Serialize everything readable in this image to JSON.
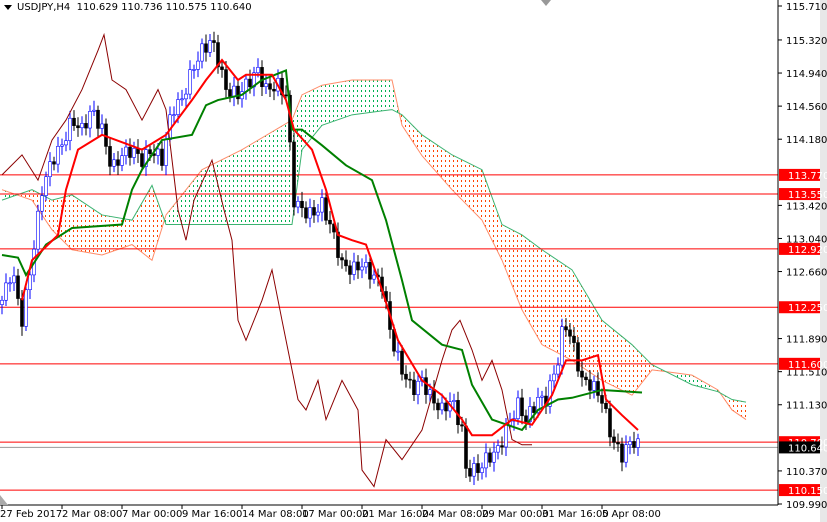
{
  "header": {
    "symbol": "USDJPY,H4",
    "ohlc": "110.629 110.736 110.575 110.640"
  },
  "colors": {
    "bull": "#0000ff",
    "bear": "#000000",
    "tenkan": "#ff0000",
    "kijun": "#008000",
    "chikou": "#8b0000",
    "cloud_up": "#00b050",
    "cloud_down": "#ff4500",
    "level": "#ff0000"
  },
  "chart_data": {
    "type": "candlestick",
    "title": "USDJPY,H4",
    "ylim": [
      109.99,
      115.71
    ],
    "y_ticks": [
      "115.710",
      "115.320",
      "114.940",
      "114.560",
      "114.180",
      "113.420",
      "113.040",
      "112.660",
      "111.890",
      "111.510",
      "111.130",
      "110.370",
      "109.990"
    ],
    "x_labels": [
      "27 Feb 2017",
      "2 Mar 08:00",
      "7 Mar 00:00",
      "9 Mar 16:00",
      "14 Mar 08:00",
      "17 Mar 00:00",
      "21 Mar 16:00",
      "24 Mar 08:00",
      "29 Mar 00:00",
      "31 Mar 16:00",
      "5 Apr 08:00"
    ],
    "bars_per_label": 15,
    "close": [
      [
        0,
        112.33
      ],
      [
        2.5,
        112.68
      ],
      [
        5,
        112.1
      ],
      [
        7.5,
        112.79
      ],
      [
        10,
        113.6
      ],
      [
        12.5,
        113.94
      ],
      [
        15,
        114.11
      ],
      [
        17.5,
        114.4
      ],
      [
        20,
        114.29
      ],
      [
        22.5,
        114.52
      ],
      [
        25,
        114.29
      ],
      [
        27.5,
        113.83
      ],
      [
        30,
        114.0
      ],
      [
        32.5,
        114.06
      ],
      [
        35,
        113.94
      ],
      [
        37.5,
        114.06
      ],
      [
        40,
        113.94
      ],
      [
        42.5,
        114.52
      ],
      [
        45,
        114.63
      ],
      [
        47.5,
        114.97
      ],
      [
        50,
        115.2
      ],
      [
        52.5,
        115.32
      ],
      [
        54,
        115.09
      ],
      [
        56,
        114.75
      ],
      [
        59,
        114.69
      ],
      [
        61,
        114.8
      ],
      [
        64,
        114.97
      ],
      [
        66,
        114.75
      ],
      [
        69,
        114.8
      ],
      [
        71,
        114.69
      ],
      [
        73,
        113.48
      ],
      [
        75,
        113.37
      ],
      [
        77.5,
        113.31
      ],
      [
        80,
        113.43
      ],
      [
        82.5,
        113.14
      ],
      [
        85,
        112.74
      ],
      [
        87.5,
        112.68
      ],
      [
        90,
        112.74
      ],
      [
        92.5,
        112.62
      ],
      [
        95,
        112.51
      ],
      [
        97.5,
        111.87
      ],
      [
        100,
        111.53
      ],
      [
        102.5,
        111.3
      ],
      [
        105,
        111.41
      ],
      [
        107.5,
        111.19
      ],
      [
        110,
        111.07
      ],
      [
        112.5,
        111.19
      ],
      [
        115,
        110.84
      ],
      [
        116,
        110.38
      ],
      [
        119,
        110.38
      ],
      [
        121,
        110.5
      ],
      [
        124,
        110.61
      ],
      [
        126,
        110.84
      ],
      [
        129,
        111.13
      ],
      [
        131,
        110.96
      ],
      [
        134,
        111.19
      ],
      [
        136,
        111.19
      ],
      [
        139,
        111.64
      ],
      [
        140.5,
        112.1
      ],
      [
        142.5,
        111.87
      ],
      [
        145,
        111.41
      ],
      [
        147.5,
        111.36
      ],
      [
        150,
        111.19
      ],
      [
        152.5,
        110.73
      ],
      [
        155,
        110.55
      ],
      [
        157.5,
        110.73
      ],
      [
        159.5,
        110.64
      ]
    ],
    "tenkan": [
      [
        5,
        112.33
      ],
      [
        7.5,
        112.79
      ],
      [
        14,
        113.08
      ],
      [
        16,
        113.6
      ],
      [
        19,
        114.06
      ],
      [
        25,
        114.23
      ],
      [
        35,
        114.06
      ],
      [
        41,
        114.23
      ],
      [
        47.5,
        114.63
      ],
      [
        51,
        114.86
      ],
      [
        55,
        115.09
      ],
      [
        59,
        114.86
      ],
      [
        61,
        114.92
      ],
      [
        67.5,
        114.92
      ],
      [
        71,
        114.63
      ],
      [
        73,
        114.29
      ],
      [
        77.5,
        114.06
      ],
      [
        81,
        113.6
      ],
      [
        84,
        113.08
      ],
      [
        87.5,
        113.02
      ],
      [
        91,
        112.97
      ],
      [
        95,
        112.45
      ],
      [
        99,
        111.87
      ],
      [
        105,
        111.41
      ],
      [
        110,
        111.24
      ],
      [
        115,
        110.96
      ],
      [
        117.5,
        110.78
      ],
      [
        122.5,
        110.78
      ],
      [
        127.5,
        110.96
      ],
      [
        132.5,
        110.9
      ],
      [
        137.5,
        111.24
      ],
      [
        141,
        111.64
      ],
      [
        145,
        111.64
      ],
      [
        149,
        111.7
      ],
      [
        151,
        111.19
      ],
      [
        155,
        111.01
      ],
      [
        159,
        110.84
      ]
    ],
    "kijun": [
      [
        0,
        112.85
      ],
      [
        4,
        112.82
      ],
      [
        6,
        112.62
      ],
      [
        11,
        112.97
      ],
      [
        17.5,
        113.16
      ],
      [
        30,
        113.2
      ],
      [
        32.5,
        113.6
      ],
      [
        35,
        113.83
      ],
      [
        40,
        114.17
      ],
      [
        47.5,
        114.23
      ],
      [
        51,
        114.57
      ],
      [
        54,
        114.63
      ],
      [
        60,
        114.69
      ],
      [
        65,
        114.86
      ],
      [
        71,
        114.97
      ],
      [
        72.5,
        114.29
      ],
      [
        75,
        114.29
      ],
      [
        80,
        114.11
      ],
      [
        86,
        113.88
      ],
      [
        92.5,
        113.71
      ],
      [
        96,
        113.25
      ],
      [
        100,
        112.56
      ],
      [
        102.5,
        112.1
      ],
      [
        110,
        111.82
      ],
      [
        115,
        111.76
      ],
      [
        117.5,
        111.36
      ],
      [
        122.5,
        110.96
      ],
      [
        130,
        110.84
      ],
      [
        134,
        111.07
      ],
      [
        139,
        111.19
      ],
      [
        142.5,
        111.21
      ],
      [
        150,
        111.3
      ],
      [
        160,
        111.27
      ]
    ],
    "chikou": [
      [
        0,
        113.77
      ],
      [
        5,
        114.0
      ],
      [
        9,
        113.71
      ],
      [
        12.5,
        114.17
      ],
      [
        16,
        114.4
      ],
      [
        20,
        114.75
      ],
      [
        24,
        115.2
      ],
      [
        25.5,
        115.38
      ],
      [
        27.5,
        114.86
      ],
      [
        31,
        114.75
      ],
      [
        35,
        114.4
      ],
      [
        39,
        114.75
      ],
      [
        41,
        114.52
      ],
      [
        44,
        113.37
      ],
      [
        46,
        113.02
      ],
      [
        48,
        113.48
      ],
      [
        52.5,
        113.94
      ],
      [
        55.5,
        113.37
      ],
      [
        57.5,
        113.02
      ],
      [
        59,
        112.1
      ],
      [
        61,
        111.87
      ],
      [
        65,
        112.33
      ],
      [
        67.5,
        112.68
      ],
      [
        70,
        112.1
      ],
      [
        74,
        111.19
      ],
      [
        76,
        111.07
      ],
      [
        79,
        111.41
      ],
      [
        81,
        110.96
      ],
      [
        85,
        111.41
      ],
      [
        89,
        111.07
      ],
      [
        90,
        110.38
      ],
      [
        93,
        110.19
      ],
      [
        96,
        110.73
      ],
      [
        100,
        110.5
      ],
      [
        105,
        110.84
      ],
      [
        110,
        111.64
      ],
      [
        112.5,
        111.99
      ],
      [
        114.5,
        112.1
      ],
      [
        117.5,
        111.76
      ],
      [
        120,
        111.41
      ],
      [
        122.5,
        111.64
      ],
      [
        125,
        111.3
      ],
      [
        127.5,
        110.73
      ],
      [
        130,
        110.67
      ],
      [
        132.5,
        110.67
      ]
    ],
    "senkou_a": [
      [
        0,
        113.6
      ],
      [
        7.5,
        113.48
      ],
      [
        12.5,
        113.14
      ],
      [
        17.5,
        112.91
      ],
      [
        25,
        112.85
      ],
      [
        32.5,
        112.97
      ],
      [
        37.5,
        112.79
      ],
      [
        41,
        113.31
      ],
      [
        50,
        113.83
      ],
      [
        60,
        114.06
      ],
      [
        72.5,
        114.4
      ],
      [
        75,
        114.69
      ],
      [
        80,
        114.8
      ],
      [
        87.5,
        114.86
      ],
      [
        97.5,
        114.86
      ],
      [
        100,
        114.34
      ],
      [
        105,
        113.99
      ],
      [
        112.5,
        113.6
      ],
      [
        120,
        113.25
      ],
      [
        125,
        112.79
      ],
      [
        130,
        112.22
      ],
      [
        135,
        111.82
      ],
      [
        142.5,
        111.64
      ],
      [
        150,
        111.41
      ],
      [
        157.5,
        111.24
      ],
      [
        162.5,
        111.53
      ],
      [
        166,
        111.51
      ],
      [
        172.5,
        111.47
      ],
      [
        179,
        111.3
      ],
      [
        182.5,
        111.07
      ],
      [
        186,
        110.96
      ]
    ],
    "senkou_b": [
      [
        0,
        113.48
      ],
      [
        7.5,
        113.6
      ],
      [
        12.5,
        113.48
      ],
      [
        17.5,
        113.54
      ],
      [
        25,
        113.31
      ],
      [
        32.5,
        113.25
      ],
      [
        37.5,
        113.65
      ],
      [
        41,
        113.2
      ],
      [
        50,
        113.2
      ],
      [
        60,
        113.2
      ],
      [
        72.5,
        113.2
      ],
      [
        75,
        114.06
      ],
      [
        80,
        114.34
      ],
      [
        87.5,
        114.46
      ],
      [
        97.5,
        114.52
      ],
      [
        100,
        114.46
      ],
      [
        105,
        114.23
      ],
      [
        112.5,
        114.0
      ],
      [
        120,
        113.83
      ],
      [
        125,
        113.2
      ],
      [
        130,
        113.08
      ],
      [
        135,
        112.91
      ],
      [
        142.5,
        112.68
      ],
      [
        150,
        112.1
      ],
      [
        157.5,
        111.82
      ],
      [
        162.5,
        111.59
      ],
      [
        166,
        111.51
      ],
      [
        172.5,
        111.36
      ],
      [
        179,
        111.28
      ],
      [
        182.5,
        111.19
      ],
      [
        186,
        111.16
      ]
    ],
    "levels": [
      {
        "value": "113.770"
      },
      {
        "value": "113.550"
      },
      {
        "value": "112.920"
      },
      {
        "value": "112.250"
      },
      {
        "value": "111.600"
      },
      {
        "value": "110.700"
      },
      {
        "value": "110.150"
      }
    ],
    "current_price": "110.640"
  }
}
